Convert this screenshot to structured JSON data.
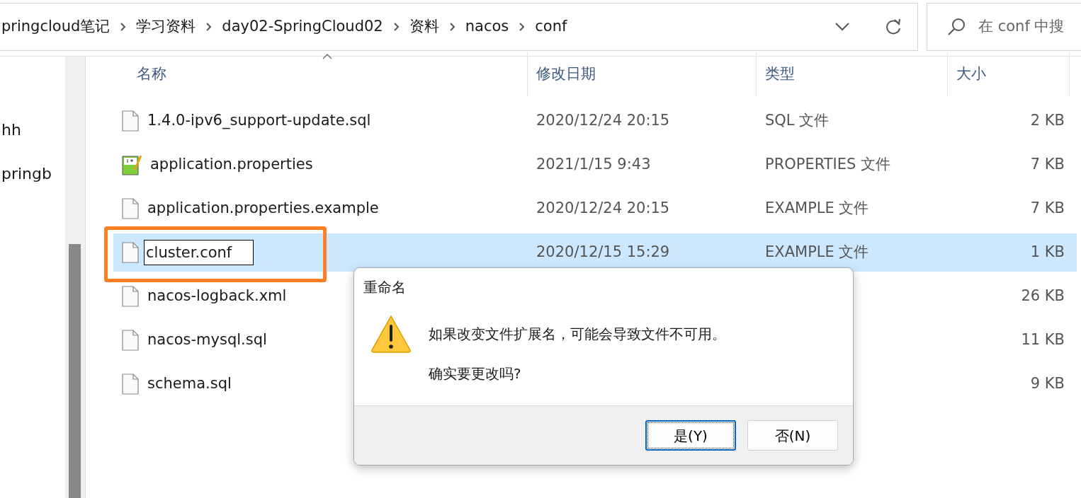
{
  "address_bar": {
    "breadcrumbs": [
      "pringcloud笔记",
      "学习资料",
      "day02-SpringCloud02",
      "资料",
      "nacos",
      "conf"
    ]
  },
  "search": {
    "placeholder": "在 conf 中搜"
  },
  "sidebar": {
    "items": [
      "hh",
      "pringb"
    ]
  },
  "table": {
    "columns": [
      {
        "label": "名称",
        "sorted": true
      },
      {
        "label": "修改日期",
        "sorted": false
      },
      {
        "label": "类型",
        "sorted": false
      },
      {
        "label": "大小",
        "sorted": false
      }
    ],
    "rows": [
      {
        "kind": "file",
        "name": "1.4.0-ipv6_support-update.sql",
        "date": "2020/12/24 20:15",
        "type": "SQL 文件",
        "size": "2 KB",
        "selected": false,
        "renaming": false,
        "highlighted": false
      },
      {
        "kind": "notepad",
        "name": "application.properties",
        "date": "2021/1/15 9:43",
        "type": "PROPERTIES 文件",
        "size": "7 KB",
        "selected": false,
        "renaming": false,
        "highlighted": false
      },
      {
        "kind": "file",
        "name": "application.properties.example",
        "date": "2020/12/24 20:15",
        "type": "EXAMPLE 文件",
        "size": "7 KB",
        "selected": false,
        "renaming": false,
        "highlighted": false
      },
      {
        "kind": "file",
        "name": "cluster.conf",
        "date": "2020/12/15 15:29",
        "type": "EXAMPLE 文件",
        "size": "1 KB",
        "selected": true,
        "renaming": true,
        "highlighted": true
      },
      {
        "kind": "file",
        "name": "nacos-logback.xml",
        "size": "26 KB",
        "selected": false,
        "renaming": false,
        "highlighted": false
      },
      {
        "kind": "file",
        "name": "nacos-mysql.sql",
        "size": "11 KB",
        "selected": false,
        "renaming": false,
        "highlighted": false
      },
      {
        "kind": "file",
        "name": "schema.sql",
        "size": "9 KB",
        "selected": false,
        "renaming": false,
        "highlighted": false
      }
    ]
  },
  "dialog": {
    "title": "重命名",
    "kind": "warning",
    "message": "如果改变文件扩展名，可能会导致文件不可用。",
    "question": "确实要更改吗?",
    "buttons": [
      {
        "label": "是(Y)",
        "default": true
      },
      {
        "label": "否(N)",
        "default": false
      }
    ]
  }
}
